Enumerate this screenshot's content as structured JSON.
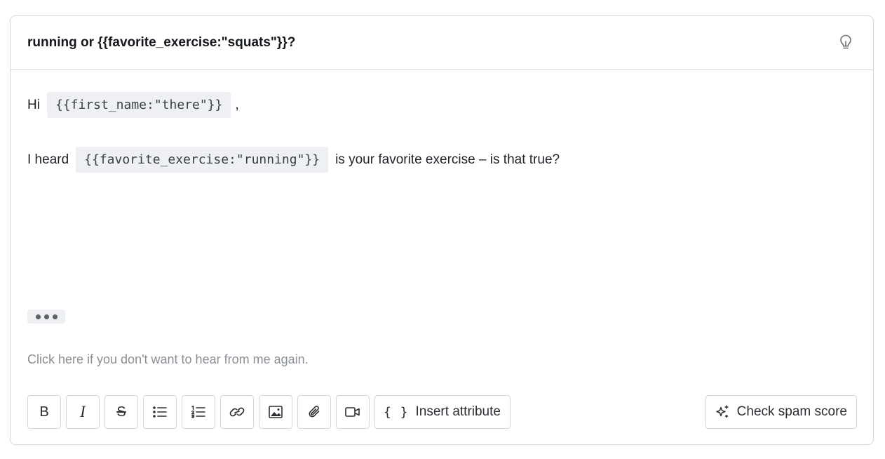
{
  "subject": {
    "text": "running or {{favorite_exercise:\"squats\"}}?",
    "hint_icon": "lightbulb-icon"
  },
  "body": {
    "greeting_prefix": "Hi",
    "first_name_chip": "{{first_name:\"there\"}}",
    "greeting_suffix": ",",
    "line2_prefix": "I heard",
    "exercise_chip": "{{favorite_exercise:\"running\"}}",
    "line2_suffix": "is your favorite exercise – is that true?",
    "unsubscribe_text": "Click here if you don't want to hear from me again."
  },
  "toolbar": {
    "bold_label": "B",
    "italic_label": "I",
    "strike_label": "S",
    "insert_attribute_icon": "{ }",
    "insert_attribute_label": "Insert attribute",
    "icons": [
      "bold-icon",
      "italic-icon",
      "strikethrough-icon",
      "bullet-list-icon",
      "numbered-list-icon",
      "link-icon",
      "image-icon",
      "paperclip-icon",
      "video-icon",
      "braces-icon"
    ]
  },
  "spam": {
    "label": "Check spam score",
    "icon": "sparkle-icon"
  }
}
